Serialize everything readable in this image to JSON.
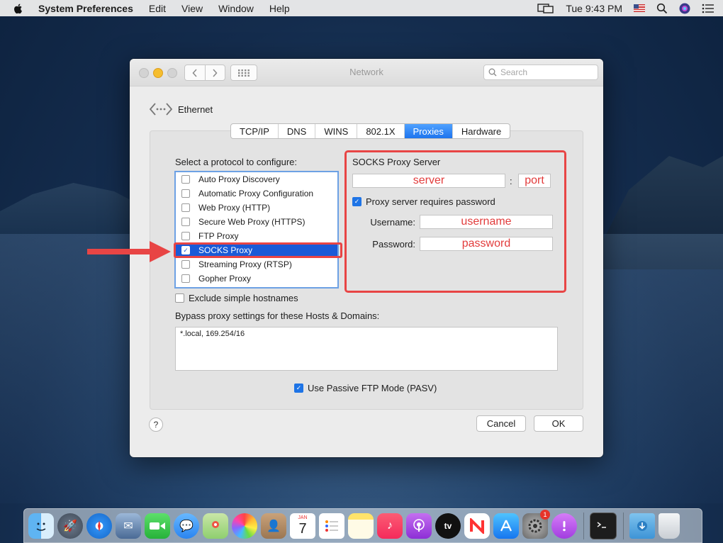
{
  "menubar": {
    "app": "System Preferences",
    "items": [
      "Edit",
      "View",
      "Window",
      "Help"
    ],
    "clock": "Tue 9:43 PM"
  },
  "window": {
    "title": "Network",
    "search_placeholder": "Search",
    "interface_name": "Ethernet",
    "tabs": [
      "TCP/IP",
      "DNS",
      "WINS",
      "802.1X",
      "Proxies",
      "Hardware"
    ],
    "active_tab": "Proxies"
  },
  "proxies": {
    "select_label": "Select a protocol to configure:",
    "protocols": [
      {
        "label": "Auto Proxy Discovery",
        "checked": false
      },
      {
        "label": "Automatic Proxy Configuration",
        "checked": false
      },
      {
        "label": "Web Proxy (HTTP)",
        "checked": false
      },
      {
        "label": "Secure Web Proxy (HTTPS)",
        "checked": false
      },
      {
        "label": "FTP Proxy",
        "checked": false
      },
      {
        "label": "SOCKS Proxy",
        "checked": true
      },
      {
        "label": "Streaming Proxy (RTSP)",
        "checked": false
      },
      {
        "label": "Gopher Proxy",
        "checked": false
      }
    ],
    "exclude_label": "Exclude simple hostnames",
    "bypass_label": "Bypass proxy settings for these Hosts & Domains:",
    "bypass_value": "*.local, 169.254/16",
    "pasv_label": "Use Passive FTP Mode (PASV)",
    "socks": {
      "title": "SOCKS Proxy Server",
      "server_value": "server",
      "colon": ":",
      "port_value": "port",
      "requires_password_label": "Proxy server requires password",
      "username_label": "Username:",
      "username_value": "username",
      "password_label": "Password:",
      "password_value": "password"
    }
  },
  "buttons": {
    "help": "?",
    "cancel": "Cancel",
    "ok": "OK"
  },
  "dock": {
    "calendar_month": "JAN",
    "calendar_day": "7",
    "appletv_label": "tv",
    "settings_badge": "1"
  },
  "colors": {
    "annotation_red": "#e84545",
    "selection_blue": "#1a5ad7",
    "tab_active_blue": "#1d74ee"
  }
}
